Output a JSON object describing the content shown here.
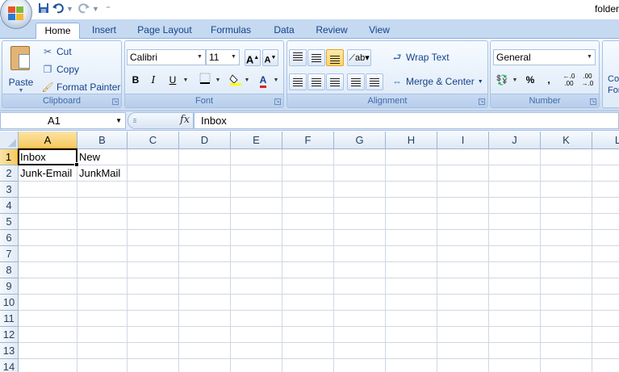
{
  "window": {
    "title": "folder"
  },
  "quick_access": {
    "save_icon": "save-icon",
    "undo_icon": "undo-icon",
    "redo_icon": "redo-icon"
  },
  "tabs": [
    {
      "label": "Home",
      "active": true
    },
    {
      "label": "Insert",
      "active": false
    },
    {
      "label": "Page Layout",
      "active": false
    },
    {
      "label": "Formulas",
      "active": false
    },
    {
      "label": "Data",
      "active": false
    },
    {
      "label": "Review",
      "active": false
    },
    {
      "label": "View",
      "active": false
    }
  ],
  "ribbon": {
    "clipboard": {
      "paste": "Paste",
      "cut": "Cut",
      "copy": "Copy",
      "format_painter": "Format Painter",
      "label": "Clipboard"
    },
    "font": {
      "name": "Calibri",
      "size": "11",
      "bold": "B",
      "italic": "I",
      "underline": "U",
      "grow": "A",
      "shrink": "A",
      "font_color": "A",
      "label": "Font"
    },
    "alignment": {
      "wrap_text": "Wrap Text",
      "merge_center": "Merge & Center",
      "label": "Alignment"
    },
    "number": {
      "format": "General",
      "percent": "%",
      "comma": ",",
      "label": "Number"
    },
    "styles_partial": {
      "line1": "Co",
      "line2": "For"
    }
  },
  "formula_bar": {
    "name_box": "A1",
    "fx": "fx",
    "content": "Inbox"
  },
  "sheet": {
    "columns": [
      "A",
      "B",
      "C",
      "D",
      "E",
      "F",
      "G",
      "H",
      "I",
      "J",
      "K",
      "L"
    ],
    "rows": [
      "1",
      "2",
      "3",
      "4",
      "5",
      "6",
      "7",
      "8",
      "9",
      "10",
      "11",
      "12",
      "13",
      "14"
    ],
    "selected_cell": "A1",
    "cells": {
      "A1": "Inbox",
      "B1": "New",
      "A2": "Junk-Email",
      "B2": "JunkMail"
    }
  },
  "colors": {
    "tab_bar": "#c5d9f1",
    "ribbon_label": "#3e6aaa",
    "selected_header": "#f8c95e",
    "gridline": "#d0d7e5"
  }
}
